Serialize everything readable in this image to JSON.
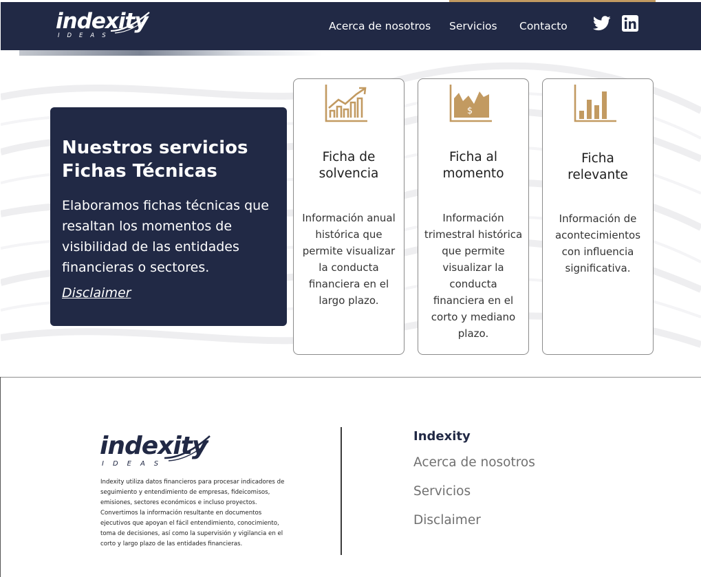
{
  "brand": {
    "name": "indexity",
    "tagline": "IDEAS"
  },
  "colors": {
    "navy": "#212945",
    "gold": "#c29a61",
    "gray_text": "#707070"
  },
  "nav": {
    "items": [
      "Acerca de nosotros",
      "Servicios",
      "Contacto"
    ],
    "social": [
      "twitter-icon",
      "linkedin-icon"
    ]
  },
  "services": {
    "title_line1": "Nuestros servicios",
    "title_line2": "Fichas Técnicas",
    "description": "Elaboramos fichas técnicas que resaltan los momentos de visibilidad de las entidades financieras o sectores.",
    "disclaimer_link": "Disclaimer",
    "cards": [
      {
        "icon": "growth-chart-icon",
        "title_line1": "Ficha de",
        "title_line2": "solvencia",
        "text": [
          "Información anual",
          "histórica que",
          "permite visualizar",
          "la conducta",
          "financiera en el",
          "largo plazo."
        ]
      },
      {
        "icon": "money-area-chart-icon",
        "title_line1": "Ficha al",
        "title_line2": "momento",
        "text": [
          "Información",
          "trimestral histórica",
          "que permite",
          "visualizar la",
          "conducta",
          "financiera en el",
          "corto y mediano",
          "plazo."
        ]
      },
      {
        "icon": "bar-chart-icon",
        "title_line1": "Ficha",
        "title_line2": "relevante",
        "text": [
          "Información de",
          "acontecimientos",
          "con influencia",
          "significativa."
        ]
      }
    ]
  },
  "footer": {
    "about": [
      "Indexity utiliza datos financieros para procesar indicadores de",
      "seguimiento y entendimiento de empresas, fideicomisos,",
      "emisiones, sectores económicos e incluso proyectos.",
      "Convertimos la información resultante en documentos",
      "ejecutivos que apoyan el fácil entendimiento, conocimiento,",
      "toma de decisiones, así como la supervisión y vigilancia en el",
      "corto y largo plazo de las entidades financieras."
    ],
    "links_title": "Indexity",
    "links": [
      "Acerca de nosotros",
      "Servicios",
      "Disclaimer"
    ]
  }
}
